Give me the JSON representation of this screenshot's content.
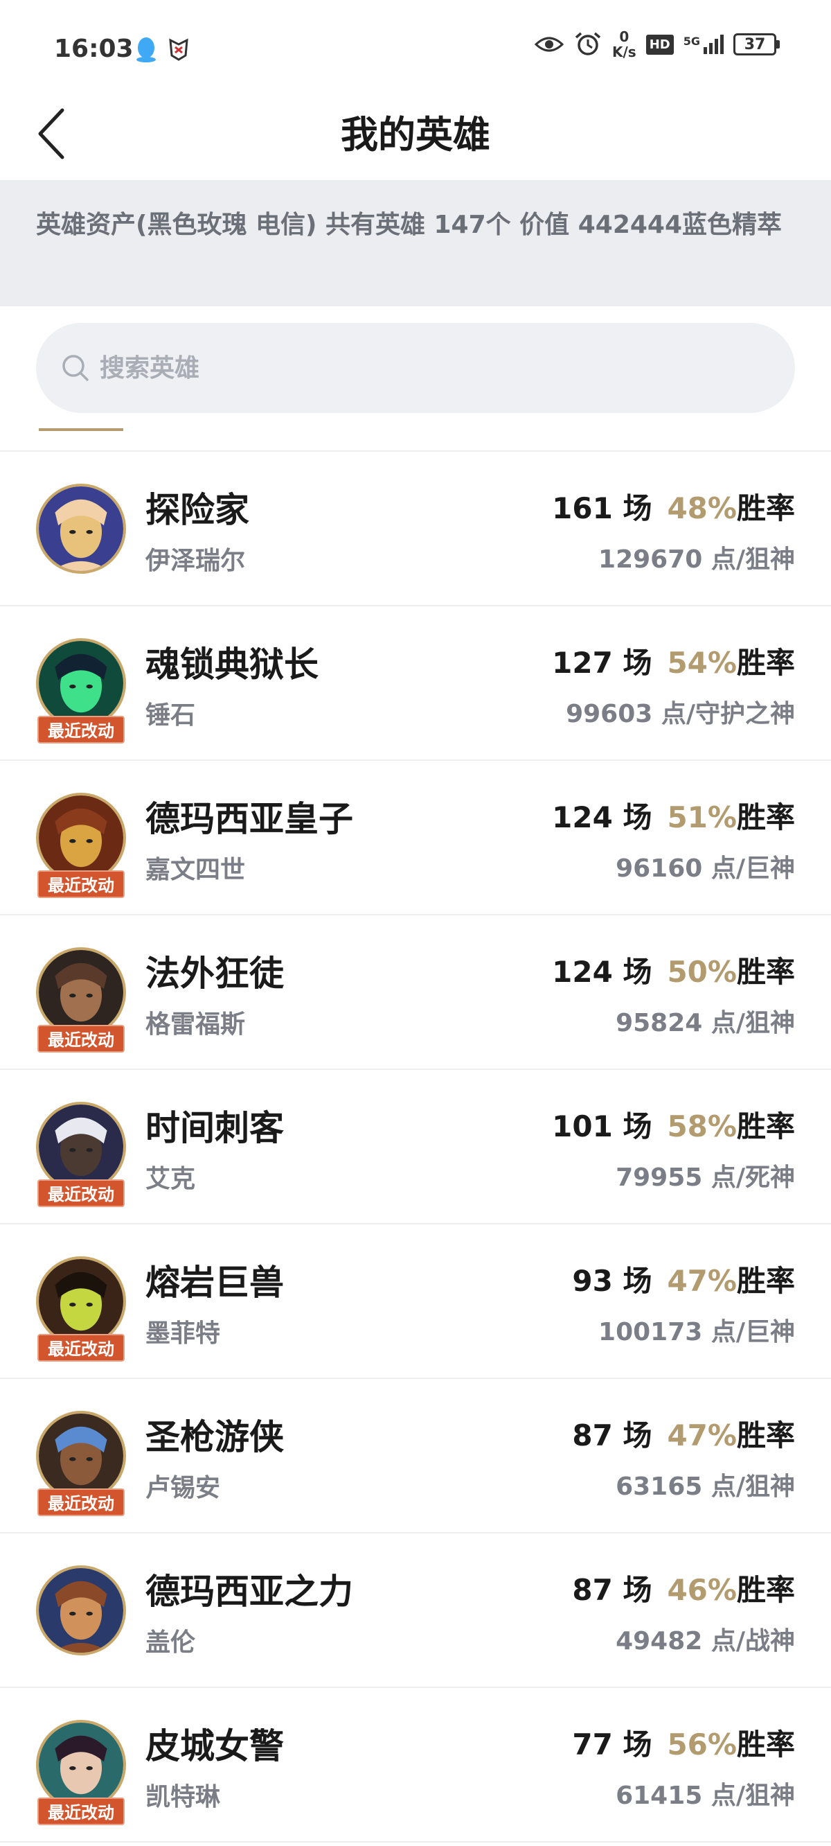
{
  "status": {
    "time": "16:03",
    "net_speed_value": "0",
    "net_speed_unit": "K/s",
    "hd": "HD",
    "network": "5G",
    "battery": "37"
  },
  "header": {
    "title": "我的英雄",
    "back_icon": "chevron-left-icon"
  },
  "summary": {
    "text": "英雄资产(黑色玫瑰 电信) 共有英雄 147个 价值 442444蓝色精萃"
  },
  "search": {
    "placeholder": "搜索英雄",
    "value": ""
  },
  "colors": {
    "accent_gold": "#b39b70",
    "badge_orange": "#d2552e",
    "summary_bg": "#ecedf1"
  },
  "heroes": [
    {
      "title": "探险家",
      "name": "伊泽瑞尔",
      "games": "161 场",
      "winrate": "48%",
      "winrate_label": "胜率",
      "points": "129670 点/狙神",
      "badge": "",
      "avatar": "ezreal-avatar"
    },
    {
      "title": "魂锁典狱长",
      "name": "锤石",
      "games": "127 场",
      "winrate": "54%",
      "winrate_label": "胜率",
      "points": "99603 点/守护之神",
      "badge": "最近改动",
      "avatar": "thresh-avatar"
    },
    {
      "title": "德玛西亚皇子",
      "name": "嘉文四世",
      "games": "124 场",
      "winrate": "51%",
      "winrate_label": "胜率",
      "points": "96160 点/巨神",
      "badge": "最近改动",
      "avatar": "jarvan-avatar"
    },
    {
      "title": "法外狂徒",
      "name": "格雷福斯",
      "games": "124 场",
      "winrate": "50%",
      "winrate_label": "胜率",
      "points": "95824 点/狙神",
      "badge": "最近改动",
      "avatar": "graves-avatar"
    },
    {
      "title": "时间刺客",
      "name": "艾克",
      "games": "101 场",
      "winrate": "58%",
      "winrate_label": "胜率",
      "points": "79955 点/死神",
      "badge": "最近改动",
      "avatar": "ekko-avatar"
    },
    {
      "title": "熔岩巨兽",
      "name": "墨菲特",
      "games": "93 场",
      "winrate": "47%",
      "winrate_label": "胜率",
      "points": "100173 点/巨神",
      "badge": "最近改动",
      "avatar": "malphite-avatar"
    },
    {
      "title": "圣枪游侠",
      "name": "卢锡安",
      "games": "87 场",
      "winrate": "47%",
      "winrate_label": "胜率",
      "points": "63165 点/狙神",
      "badge": "最近改动",
      "avatar": "lucian-avatar"
    },
    {
      "title": "德玛西亚之力",
      "name": "盖伦",
      "games": "87 场",
      "winrate": "46%",
      "winrate_label": "胜率",
      "points": "49482 点/战神",
      "badge": "",
      "avatar": "garen-avatar"
    },
    {
      "title": "皮城女警",
      "name": "凯特琳",
      "games": "77 场",
      "winrate": "56%",
      "winrate_label": "胜率",
      "points": "61415 点/狙神",
      "badge": "最近改动",
      "avatar": "caitlyn-avatar"
    }
  ]
}
